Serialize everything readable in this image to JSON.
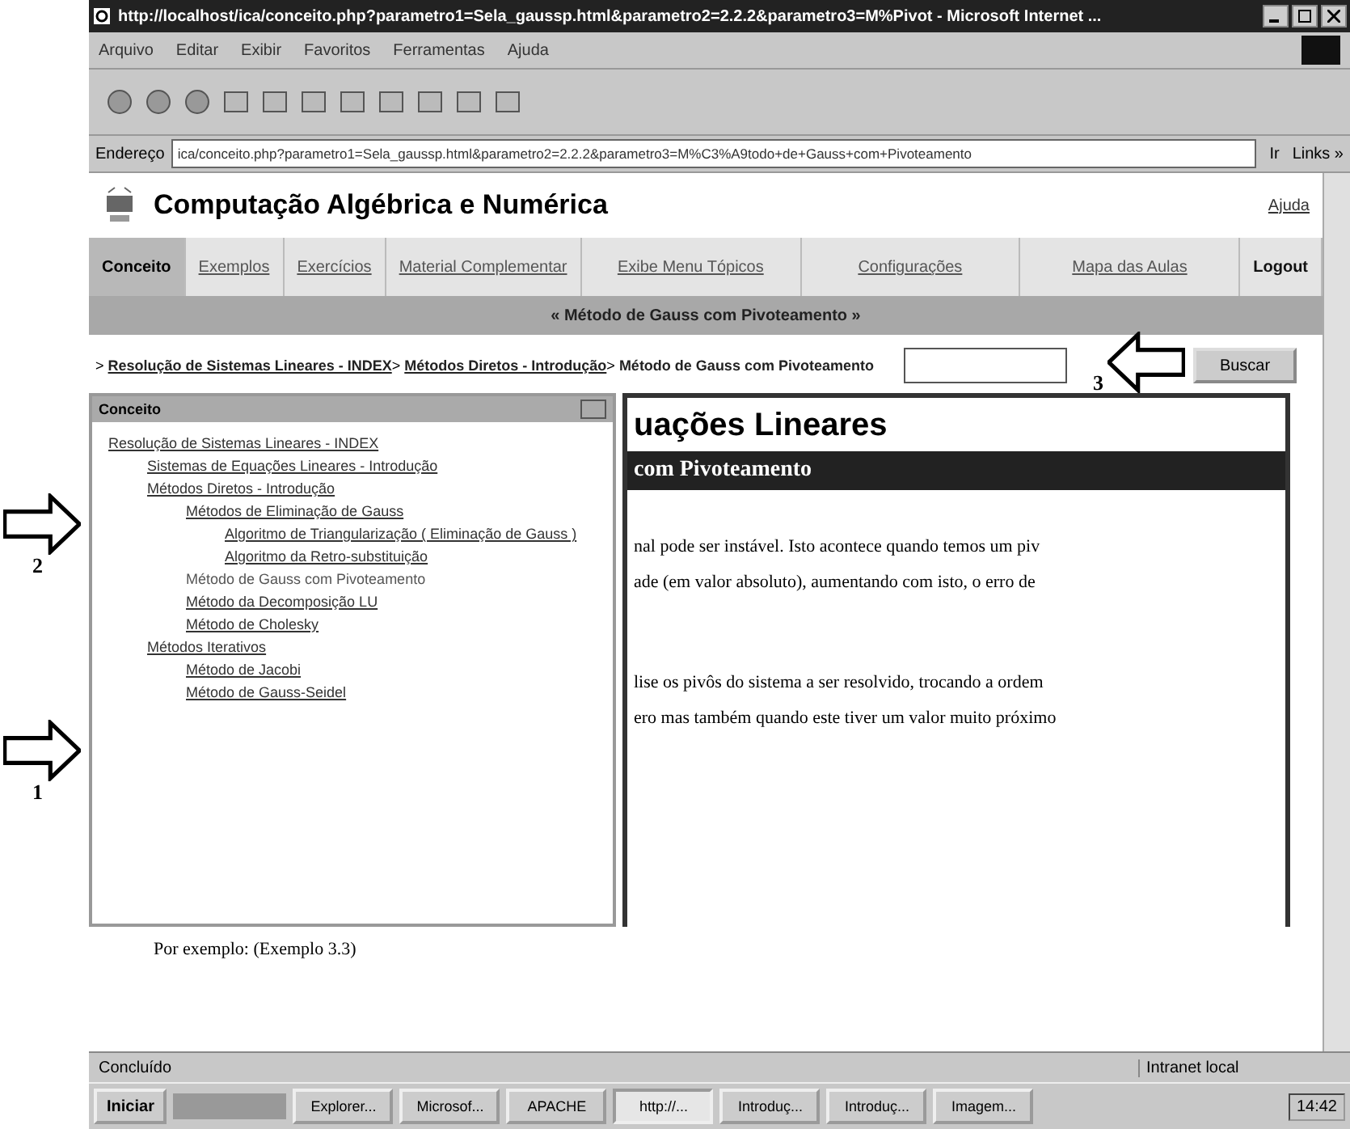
{
  "window": {
    "title": "http://localhost/ica/conceito.php?parametro1=Sela_gaussp.html&parametro2=2.2.2&parametro3=M%Pivot - Microsoft Internet ..."
  },
  "menu": [
    "Arquivo",
    "Editar",
    "Exibir",
    "Favoritos",
    "Ferramentas",
    "Ajuda"
  ],
  "address": {
    "label": "Endereço",
    "value": "ica/conceito.php?parametro1=Sela_gaussp.html&parametro2=2.2.2&parametro3=M%C3%A9todo+de+Gauss+com+Pivoteamento",
    "go": "Ir",
    "links": "Links »"
  },
  "site": {
    "title": "Computação Algébrica e Numérica",
    "help": "Ajuda"
  },
  "tabs": [
    {
      "label": "Conceito",
      "selected": true,
      "kind": "tab"
    },
    {
      "label": "Exemplos",
      "selected": false,
      "kind": "tab"
    },
    {
      "label": "Exercícios",
      "selected": false,
      "kind": "tab"
    },
    {
      "label": "Material Complementar",
      "selected": false,
      "kind": "tab"
    },
    {
      "label": "Exibe Menu Tópicos",
      "selected": false,
      "kind": "link"
    },
    {
      "label": "Configurações",
      "selected": false,
      "kind": "link"
    },
    {
      "label": "Mapa das Aulas",
      "selected": false,
      "kind": "link"
    },
    {
      "label": "Logout",
      "selected": false,
      "kind": "strong"
    }
  ],
  "topic_bar": "« Método de Gauss com Pivoteamento »",
  "breadcrumb_separator": ">",
  "breadcrumb": [
    {
      "label": "Resolução de Sistemas Lineares - INDEX",
      "kind": "link"
    },
    {
      "label": "Métodos Diretos - Introdução",
      "kind": "link"
    },
    {
      "label": "Método de Gauss com Pivoteamento",
      "kind": "current"
    }
  ],
  "search": {
    "button": "Buscar"
  },
  "tree": {
    "title": "Conceito",
    "items": [
      {
        "label": "Resolução de Sistemas Lineares - INDEX",
        "selected": false,
        "children": [
          {
            "label": "Sistemas de Equações Lineares - Introdução",
            "selected": false
          },
          {
            "label": "Métodos Diretos - Introdução",
            "selected": false,
            "children": [
              {
                "label": "Métodos de Eliminação de Gauss",
                "selected": false,
                "children": [
                  {
                    "label": "Algoritmo de Triangularização ( Eliminação de Gauss )",
                    "selected": false
                  },
                  {
                    "label": "Algoritmo da Retro-substituição",
                    "selected": false
                  }
                ]
              },
              {
                "label": "Método de Gauss com Pivoteamento",
                "selected": true
              },
              {
                "label": "Método da Decomposição LU",
                "selected": false
              },
              {
                "label": "Método de Cholesky",
                "selected": false
              }
            ]
          },
          {
            "label": "Métodos Iterativos",
            "selected": false,
            "children": [
              {
                "label": "Método de Jacobi",
                "selected": false
              },
              {
                "label": "Método de Gauss-Seidel",
                "selected": false
              }
            ]
          }
        ]
      }
    ]
  },
  "content": {
    "heading": "uações Lineares",
    "subheading": "com Pivoteamento",
    "paragraphs": [
      [
        "nal pode ser instável. Isto acontece quando temos um piv",
        "ade (em valor absoluto), aumentando com isto, o erro de"
      ],
      [
        "lise os pivôs do sistema a ser resolvido, trocando a ordem",
        "ero mas também quando este tiver um valor muito próximo"
      ]
    ],
    "example": "Por exemplo: (Exemplo 3.3)"
  },
  "status_bar": {
    "text": "Concluído",
    "zone": "Intranet local"
  },
  "taskbar": {
    "start": "Iniciar",
    "tasks": [
      {
        "label": "Explorer...",
        "selected": false
      },
      {
        "label": "Microsof...",
        "selected": false
      },
      {
        "label": "APACHE",
        "selected": false
      },
      {
        "label": "http://...",
        "selected": true
      },
      {
        "label": "Introduç...",
        "selected": false
      },
      {
        "label": "Introduç...",
        "selected": false
      },
      {
        "label": "Imagem...",
        "selected": false
      }
    ],
    "clock": "14:42"
  },
  "annotations": [
    {
      "label": "1",
      "kind": "right"
    },
    {
      "label": "2",
      "kind": "right"
    },
    {
      "label": "3",
      "kind": "left"
    }
  ]
}
